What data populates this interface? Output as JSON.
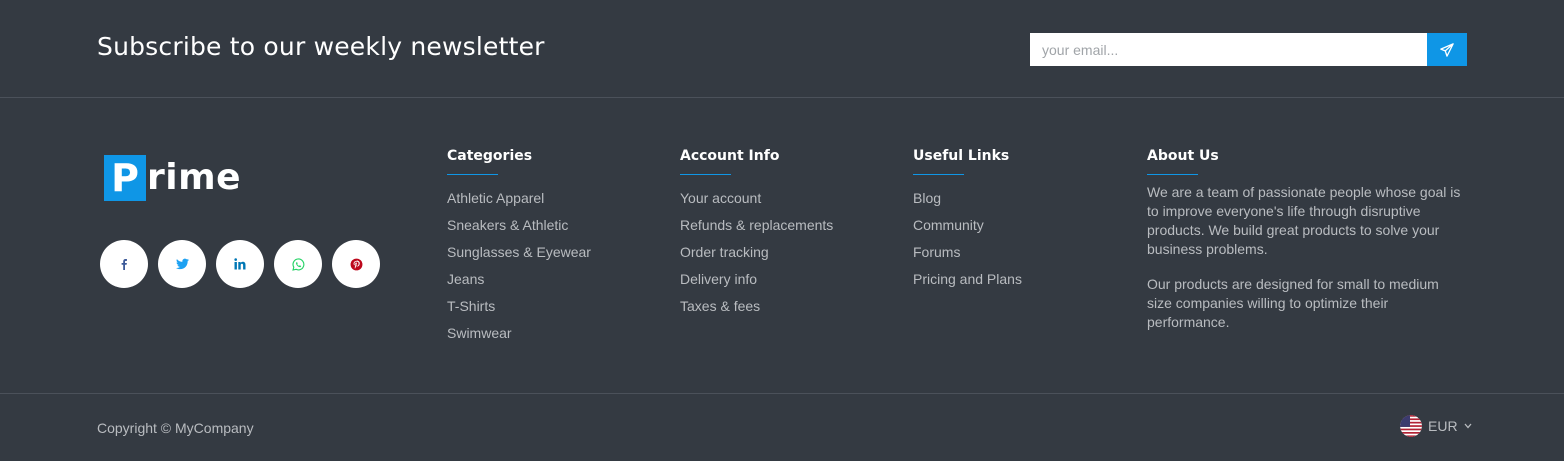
{
  "newsletter": {
    "title": "Subscribe to our weekly newsletter",
    "placeholder": "your email...",
    "send_icon": "paper-plane-icon"
  },
  "logo": {
    "first_letter": "P",
    "rest": "rime",
    "accent": "#0f96e6"
  },
  "socials": [
    {
      "name": "facebook",
      "icon": "facebook-icon",
      "color": "#3b5998"
    },
    {
      "name": "twitter",
      "icon": "twitter-icon",
      "color": "#1da1f2"
    },
    {
      "name": "linkedin",
      "icon": "linkedin-icon",
      "color": "#0077b5"
    },
    {
      "name": "whatsapp",
      "icon": "whatsapp-icon",
      "color": "#25d366"
    },
    {
      "name": "pinterest",
      "icon": "pinterest-icon",
      "color": "#bd081c"
    }
  ],
  "columns": {
    "categories": {
      "title": "Categories",
      "items": [
        "Athletic Apparel",
        "Sneakers & Athletic",
        "Sunglasses & Eyewear",
        "Jeans",
        "T-Shirts",
        "Swimwear"
      ]
    },
    "account": {
      "title": "Account Info",
      "items": [
        "Your account",
        "Refunds & replacements",
        "Order tracking",
        "Delivery info",
        "Taxes & fees"
      ]
    },
    "useful": {
      "title": "Useful Links",
      "items": [
        "Blog",
        "Community",
        "Forums",
        "Pricing and Plans"
      ]
    },
    "about": {
      "title": "About Us",
      "paragraphs": [
        "We are a team of passionate people whose goal is to improve everyone's life through disruptive products. We build great products to solve your business problems.",
        "Our products are designed for small to medium size companies willing to optimize their performance."
      ]
    }
  },
  "bottom": {
    "copyright": "Copyright © MyCompany",
    "currency": "EUR",
    "flag_icon": "us-flag-icon"
  },
  "colors": {
    "background": "#343a42",
    "accent": "#0f96e6",
    "heading": "#ffffff",
    "text": "#b9bcc0"
  }
}
